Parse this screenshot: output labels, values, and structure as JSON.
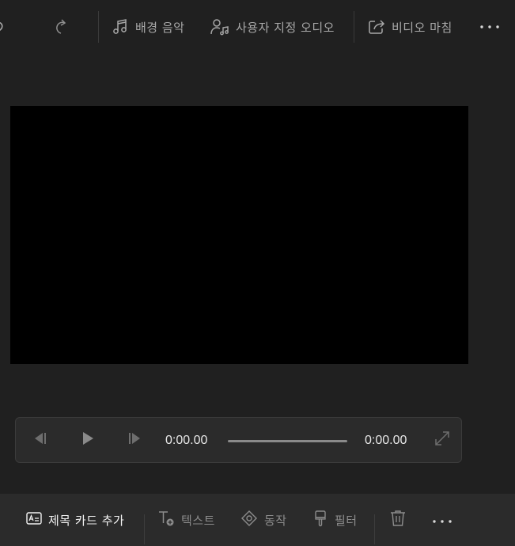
{
  "toolbar": {
    "background_music_label": "배경 음악",
    "custom_audio_label": "사용자 지정 오디오",
    "finish_video_label": "비디오 마침"
  },
  "player": {
    "current_time": "0:00.00",
    "total_time": "0:00.00",
    "progress": 0
  },
  "bottom": {
    "add_title_card_label": "제목 카드 추가",
    "text_label": "텍스트",
    "motion_label": "동작",
    "filter_label": "필터"
  },
  "colors": {
    "background": "#202020",
    "bottom_bar": "#2b2b2b",
    "preview": "#000000",
    "text_active": "#f2f2f2",
    "text_muted": "#a8a8a8"
  }
}
